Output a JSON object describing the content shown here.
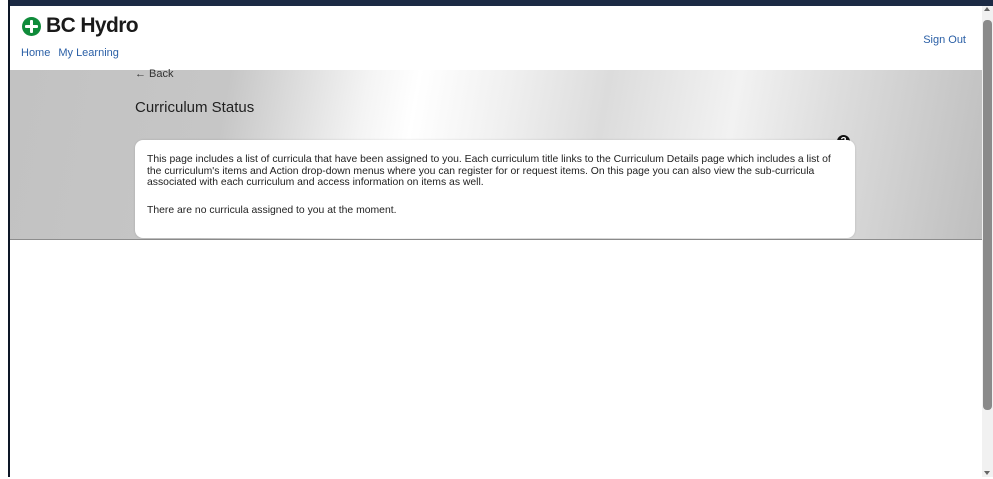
{
  "header": {
    "logo_text": "BC Hydro",
    "nav": [
      "Home",
      "My Learning"
    ],
    "sign_out": "Sign Out"
  },
  "page": {
    "back_label": "← Back",
    "title": "Curriculum Status",
    "help_icon_glyph": "?",
    "description": "This page includes a list of curricula that have been assigned to you. Each curriculum title links to the Curriculum Details page which includes a list of the curriculum's items and Action drop-down menus where you can register for or request items. On this page you can also view the sub-curricula associated with each curriculum and access information on items as well.",
    "empty_message": "There are no curricula assigned to you at the moment."
  },
  "colors": {
    "brand_green": "#0f8b3a",
    "link_blue": "#2a5fa6"
  }
}
